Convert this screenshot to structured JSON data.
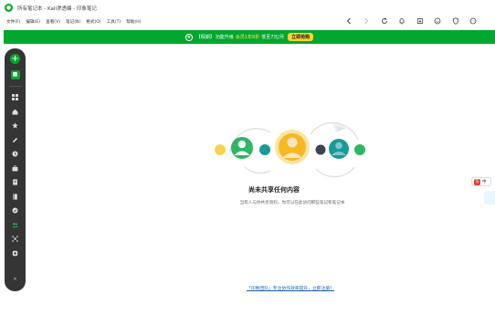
{
  "window": {
    "title": "所有笔记本 - Kali渗透编 - 印象笔记"
  },
  "menu": [
    "文件(F)",
    "编辑(E)",
    "查看(V)",
    "笔记(N)",
    "格式(O)",
    "工具(T)",
    "帮助(H)"
  ],
  "toolbar": {
    "icons": [
      "back-icon",
      "forward-icon",
      "sync-icon",
      "notifications-icon",
      "download-icon",
      "emoji-icon",
      "shield-icon",
      "more-icon"
    ]
  },
  "banner": {
    "tag": "【假期】",
    "text": "功能升级",
    "highlight": "会员1年8折",
    "price": "低至7元/月",
    "button": "立即抢购"
  },
  "sidebar": {
    "new_icon": "+",
    "items": [
      {
        "icon": "grid-icon"
      },
      {
        "icon": "home-icon"
      },
      {
        "icon": "star-icon"
      },
      {
        "icon": "pen-icon"
      },
      {
        "icon": "clock-icon"
      },
      {
        "icon": "briefcase-icon"
      },
      {
        "icon": "notebook-icon"
      },
      {
        "icon": "book-icon"
      },
      {
        "icon": "tag-icon"
      },
      {
        "icon": "shared-icon",
        "active": true
      },
      {
        "icon": "connections-icon"
      },
      {
        "icon": "trash-icon"
      }
    ],
    "expand": "»"
  },
  "empty_state": {
    "title": "尚未共享任何内容",
    "description": "当有人与你共享资料，你可以在此访问那些笔记和笔记本",
    "colors": {
      "green": "#2db665",
      "orange": "#f5b923",
      "teal": "#1a9a96",
      "yellow": "#f6d54c",
      "dark": "#3e4250"
    }
  },
  "footer": {
    "link": "「印象团队」专注协作效率提升，立即注册！"
  },
  "float": {
    "badge": "S",
    "label": "中"
  }
}
